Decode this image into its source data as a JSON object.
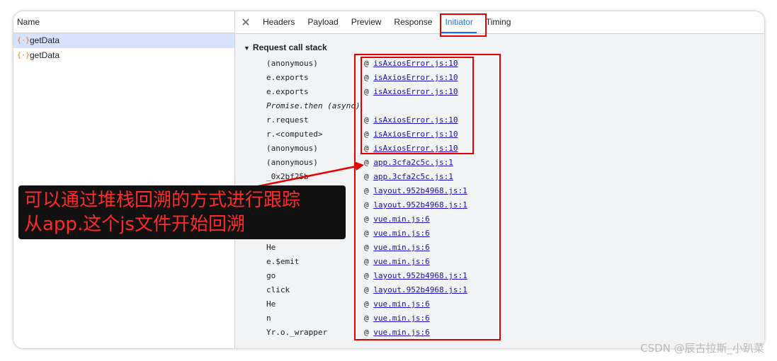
{
  "left_panel": {
    "header": "Name",
    "requests": [
      {
        "icon": "{·}",
        "name": "getData",
        "selected": true
      },
      {
        "icon": "{·}",
        "name": "getData",
        "selected": false
      }
    ]
  },
  "tabs": [
    "Headers",
    "Payload",
    "Preview",
    "Response",
    "Initiator",
    "Timing"
  ],
  "active_tab": "Initiator",
  "section": {
    "title": "Request call stack"
  },
  "frames": [
    {
      "fn": "(anonymous)",
      "at": "@",
      "link": "isAxiosError.js:10"
    },
    {
      "fn": "e.exports",
      "at": "@",
      "link": "isAxiosError.js:10"
    },
    {
      "fn": "e.exports",
      "at": "@",
      "link": "isAxiosError.js:10"
    },
    {
      "fn": "Promise.then (async)",
      "at": "",
      "link": ""
    },
    {
      "fn": "r.request",
      "at": "@",
      "link": "isAxiosError.js:10"
    },
    {
      "fn": "r.<computed>",
      "at": "@",
      "link": "isAxiosError.js:10"
    },
    {
      "fn": "(anonymous)",
      "at": "@",
      "link": "isAxiosError.js:10"
    },
    {
      "fn": "(anonymous)",
      "at": "@",
      "link": "app.3cfa2c5c.js:1"
    },
    {
      "fn": "_0x2bf25b",
      "at": "@",
      "link": "app.3cfa2c5c.js:1"
    },
    {
      "fn": "",
      "at": "@",
      "link": "layout.952b4968.js:1"
    },
    {
      "fn": "",
      "at": "@",
      "link": "layout.952b4968.js:1"
    },
    {
      "fn": "",
      "at": "@",
      "link": "vue.min.js:6"
    },
    {
      "fn": "",
      "at": "@",
      "link": "vue.min.js:6"
    },
    {
      "fn": "He",
      "at": "@",
      "link": "vue.min.js:6"
    },
    {
      "fn": "e.$emit",
      "at": "@",
      "link": "vue.min.js:6"
    },
    {
      "fn": "go",
      "at": "@",
      "link": "layout.952b4968.js:1"
    },
    {
      "fn": "click",
      "at": "@",
      "link": "layout.952b4968.js:1"
    },
    {
      "fn": "He",
      "at": "@",
      "link": "vue.min.js:6"
    },
    {
      "fn": "n",
      "at": "@",
      "link": "vue.min.js:6"
    },
    {
      "fn": "Yr.o._wrapper",
      "at": "@",
      "link": "vue.min.js:6"
    }
  ],
  "annotation": {
    "line1": "可以通过堆栈回溯的方式进行跟踪",
    "line2": "从app.这个js文件开始回溯"
  },
  "watermark": "CSDN @辰古拉斯_小趴菜",
  "colors": {
    "accent": "#1a73e8",
    "highlight_box": "#e60000",
    "annotation_text": "#ff2a2a"
  }
}
